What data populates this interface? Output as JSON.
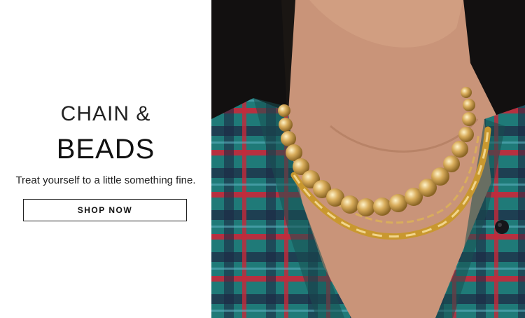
{
  "promo": {
    "eyebrow": "CHAIN &",
    "headline": "BEADS",
    "tagline": "Treat yourself to a little something fine.",
    "cta_label": "SHOP NOW"
  },
  "image": {
    "subject": "necklace-model-photo",
    "colors": {
      "hair": "#1a1613",
      "skin": "#c99479",
      "gold": "#d9ad5c",
      "plaid_teal": "#1f7a78",
      "plaid_red": "#c7283a",
      "plaid_navy": "#1d2a45"
    }
  }
}
